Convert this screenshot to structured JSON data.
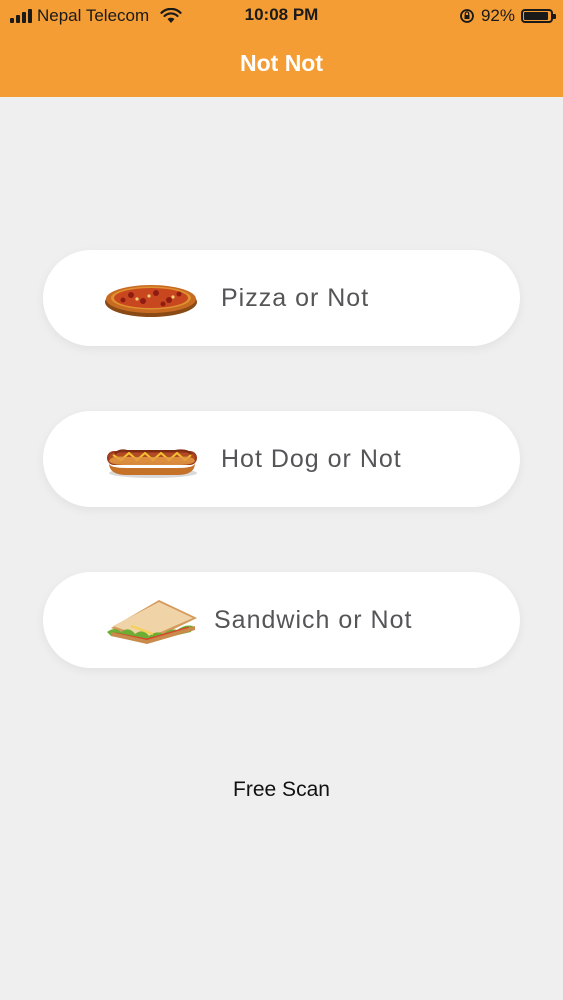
{
  "status_bar": {
    "carrier": "Nepal Telecom",
    "time": "10:08 PM",
    "battery_percent": "92%",
    "battery_level": 0.92,
    "icons": [
      "signal-icon",
      "wifi-icon",
      "orientation-lock-icon",
      "battery-icon"
    ]
  },
  "header": {
    "title": "Not Not",
    "background_color": "#f49d35"
  },
  "options": [
    {
      "label": "Pizza or Not",
      "icon": "pizza-image"
    },
    {
      "label": "Hot Dog or Not",
      "icon": "hot-dog-image"
    },
    {
      "label": "Sandwich or Not",
      "icon": "sandwich-image"
    }
  ],
  "footer": {
    "free_scan_label": "Free Scan"
  },
  "colors": {
    "page_background": "#efeff0",
    "card_background": "#ffffff",
    "label_text": "#555558"
  }
}
